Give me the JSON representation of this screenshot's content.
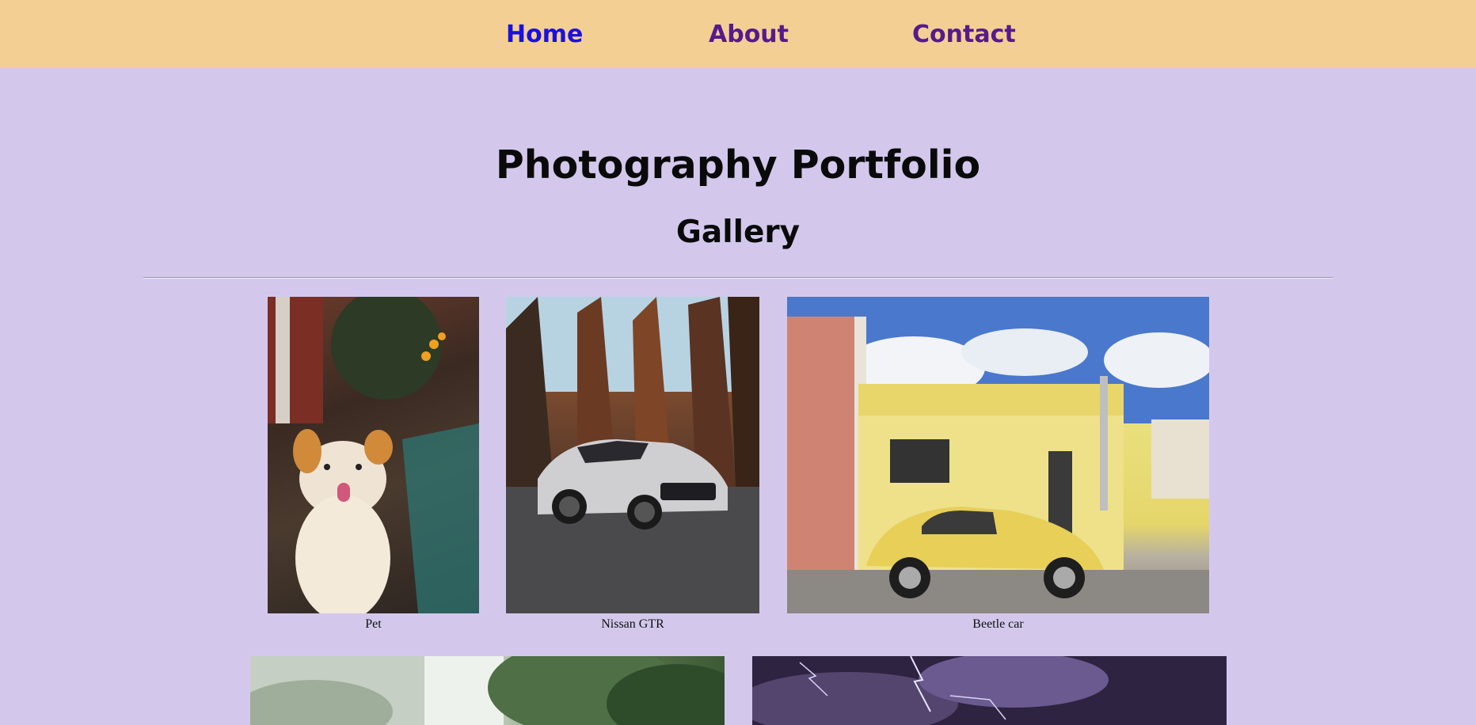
{
  "nav": {
    "items": [
      {
        "label": "Home",
        "state": "current"
      },
      {
        "label": "About"
      },
      {
        "label": "Contact"
      }
    ]
  },
  "page": {
    "title": "Photography Portfolio",
    "subtitle": "Gallery"
  },
  "gallery": {
    "row1": [
      {
        "caption": "Pet"
      },
      {
        "caption": "Nissan GTR"
      },
      {
        "caption": "Beetle car"
      }
    ],
    "row2": [
      {
        "caption": ""
      },
      {
        "caption": ""
      }
    ]
  },
  "colors": {
    "nav_background": "#f3cf94",
    "page_background": "#d3c8ec",
    "nav_link_active": "#1b10e0",
    "nav_link": "#571a8c"
  }
}
